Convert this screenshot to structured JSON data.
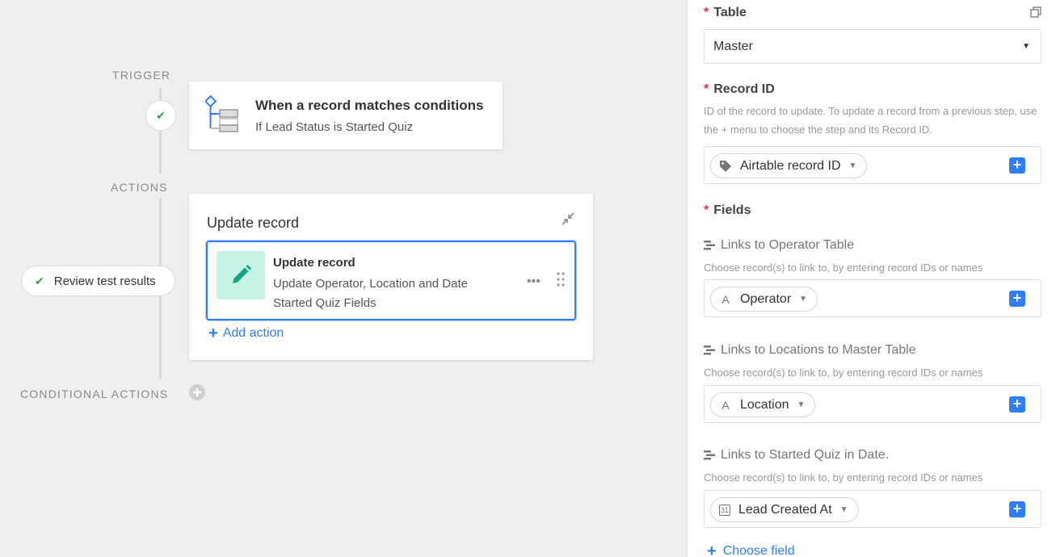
{
  "canvas": {
    "trigger_label": "TRIGGER",
    "actions_label": "ACTIONS",
    "conditional_label": "CONDITIONAL ACTIONS",
    "trigger": {
      "title": "When a record matches conditions",
      "subtitle": "If Lead Status is Started Quiz"
    },
    "action_group": {
      "title": "Update record",
      "item_title": "Update record",
      "item_desc": "Update Operator, Location and Date Started Quiz Fields",
      "more": "•••",
      "add_action": "Add action"
    },
    "review_button": "Review test results",
    "status": {
      "check": "✔"
    }
  },
  "panel": {
    "table": {
      "required": "*",
      "label": "Table",
      "value": "Master"
    },
    "record_id": {
      "required": "*",
      "label": "Record ID",
      "help": "ID of the record to update. To update a record from a previous step, use the + menu to choose the step and its Record ID.",
      "token": "Airtable record ID"
    },
    "fields_header": {
      "required": "*",
      "label": "Fields"
    },
    "fields": [
      {
        "label": "Links to Operator Table",
        "help": "Choose record(s) to link to, by entering record IDs or names",
        "token": "Operator",
        "token_icon": "A"
      },
      {
        "label": "Links to Locations to Master Table",
        "help": "Choose record(s) to link to, by entering record IDs or names",
        "token": "Location",
        "token_icon": "A"
      },
      {
        "label": "Links to Started Quiz in Date.",
        "help": "Choose record(s) to link to, by entering record IDs or names",
        "token": "Lead Created At",
        "token_icon": "31"
      }
    ],
    "choose_field": "Choose field",
    "caret": "▼",
    "plus": "+"
  },
  "colors": {
    "accent": "#2d7ff9",
    "success": "#2aa348",
    "required": "#e0325a",
    "icon_bg": "#c7f2e6",
    "icon_fg": "#11a383"
  }
}
